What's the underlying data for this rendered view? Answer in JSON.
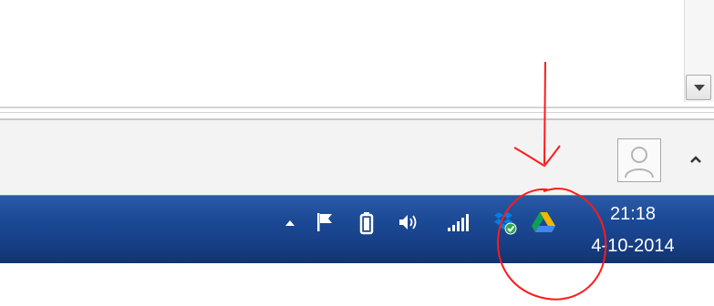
{
  "window": {
    "scrollbar": {
      "down_icon": "chevron-down"
    },
    "user_avatar": {
      "icon": "user-silhouette"
    },
    "expand_icon": "chevron-up"
  },
  "taskbar": {
    "tray_icons": [
      {
        "name": "show-hidden-icons",
        "icon": "triangle-up"
      },
      {
        "name": "action-center",
        "icon": "flag"
      },
      {
        "name": "battery",
        "icon": "battery"
      },
      {
        "name": "volume",
        "icon": "speaker"
      },
      {
        "name": "network",
        "icon": "signal-bars"
      },
      {
        "name": "dropbox",
        "icon": "dropbox-synced"
      },
      {
        "name": "google-drive",
        "icon": "google-drive"
      }
    ],
    "clock": {
      "time": "21:18",
      "date": "4-10-2014"
    }
  },
  "colors": {
    "taskbar": "#1c4a97",
    "annotation": "#ff1a1a",
    "drive_green": "#0f9d58",
    "drive_yellow": "#f4b400",
    "drive_blue": "#4285f4",
    "dropbox_blue": "#007ee5"
  }
}
